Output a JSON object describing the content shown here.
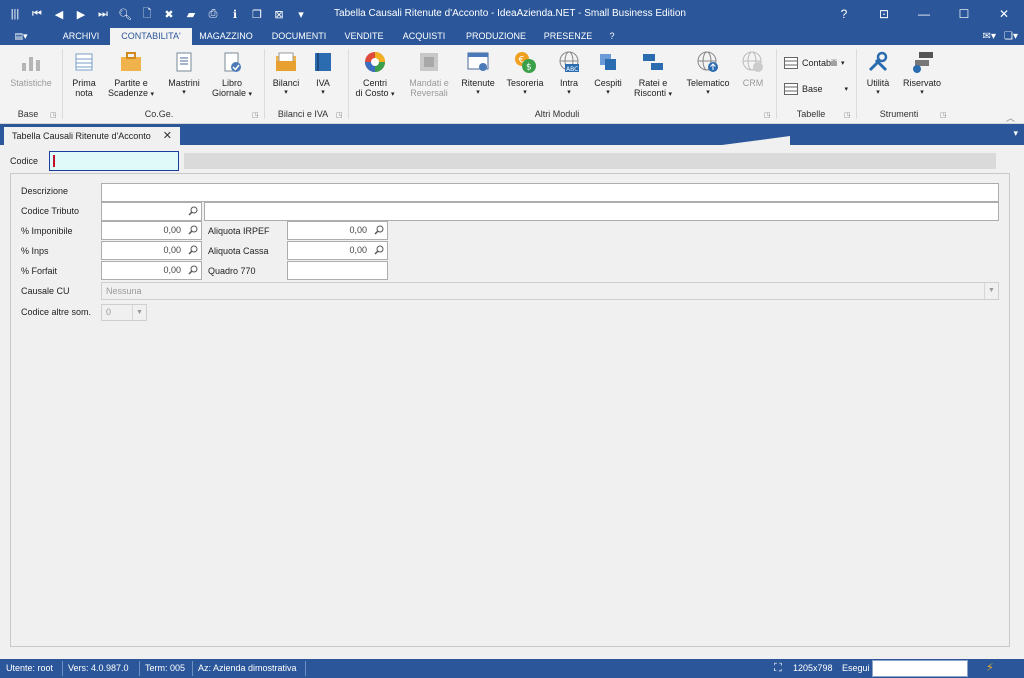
{
  "app": {
    "window_title": "Tabella Causali Ritenute d'Acconto - IdeaAzienda.NET - Small Business Edition"
  },
  "menu": {
    "tabs": [
      "ARCHIVI",
      "CONTABILITA'",
      "MAGAZZINO",
      "DOCUMENTI",
      "VENDITE",
      "ACQUISTI",
      "PRODUZIONE",
      "PRESENZE",
      "?"
    ],
    "active_tab": "CONTABILITA'"
  },
  "ribbon": {
    "buttons": {
      "statistiche": "Statistiche",
      "prima_nota_1": "Prima",
      "prima_nota_2": "nota",
      "partite_1": "Partite e",
      "partite_2": "Scadenze",
      "mastrini": "Mastrini",
      "libro_1": "Libro",
      "libro_2": "Giornale",
      "bilanci": "Bilanci",
      "iva": "IVA",
      "centri_1": "Centri",
      "centri_2": "di Costo",
      "mandati_1": "Mandati e",
      "mandati_2": "Reversali",
      "ritenute": "Ritenute",
      "tesoreria": "Tesoreria",
      "intra": "Intra",
      "cespiti": "Cespiti",
      "ratei_1": "Ratei e",
      "ratei_2": "Risconti",
      "telematico": "Telematico",
      "crm": "CRM",
      "contabili": "Contabili",
      "base_small": "Base",
      "utilita": "Utilità",
      "riservato": "Riservato"
    },
    "groups": {
      "base": "Base",
      "coge": "Co.Ge.",
      "bilanci_iva": "Bilanci e IVA",
      "altri_moduli": "Altri Moduli",
      "tabelle": "Tabelle",
      "strumenti": "Strumenti"
    }
  },
  "document_tab": {
    "title": "Tabella Causali Ritenute d'Acconto",
    "close": "✕"
  },
  "form": {
    "codice_label": "Codice",
    "codice_value": "",
    "descrizione_label": "Descrizione",
    "descrizione_value": "",
    "codice_tributo_label": "Codice Tributo",
    "codice_tributo_value": "",
    "codice_tributo_desc": "",
    "imponibile_label": "% Imponibile",
    "imponibile_value": "0,00",
    "aliquota_irpef_label": "Aliquota IRPEF",
    "aliquota_irpef_value": "0,00",
    "inps_label": "% Inps",
    "inps_value": "0,00",
    "aliquota_cassa_label": "Aliquota Cassa",
    "aliquota_cassa_value": "0,00",
    "forfait_label": "% Forfait",
    "forfait_value": "0,00",
    "quadro_770_label": "Quadro 770",
    "quadro_770_value": "",
    "causale_cu_label": "Causale CU",
    "causale_cu_value": "Nessuna",
    "codice_altre_label": "Codice altre som.",
    "codice_altre_value": "0"
  },
  "status": {
    "utente": "Utente: root",
    "versione": "Vers: 4.0.987.0",
    "term": "Term: 005",
    "azienda": "Az: Azienda dimostrativa",
    "resolution": "1205x798",
    "esegui": "Esegui"
  },
  "colors": {
    "titlebar": "#2b579a",
    "codice_field_bg": "#e0fafa",
    "codice_field_border": "#1a3fa0"
  }
}
